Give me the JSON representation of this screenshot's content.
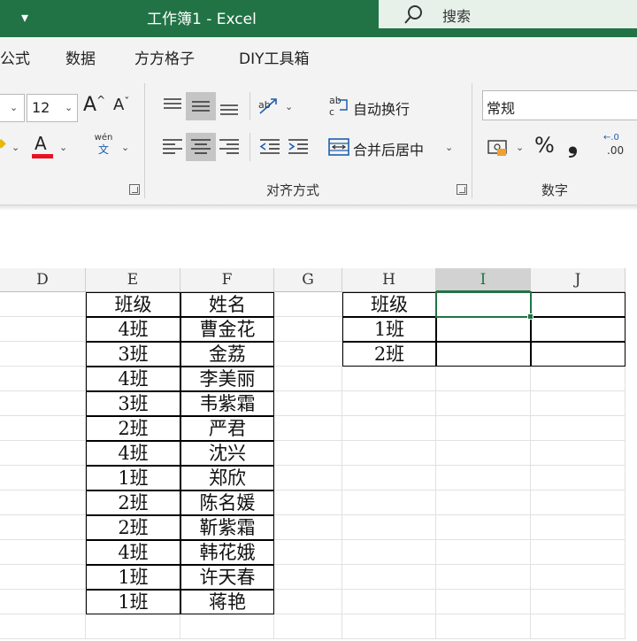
{
  "titlebar": {
    "title": "工作簿1  -  Excel",
    "search_label": "搜索",
    "quick_access_icon": "customize-qat-chevron"
  },
  "tabs": [
    "公式",
    "数据",
    "方方格子",
    "DIY工具箱"
  ],
  "ribbon": {
    "font_size": "12",
    "font_color": "#e81123",
    "wrap_text_label": "自动换行",
    "merge_center_label": "合并后居中",
    "number_format": "常规",
    "alignment_group_label": "对齐方式",
    "number_group_label": "数字",
    "wen_top": "wén",
    "wen_bottom": "文",
    "percent": "%",
    "comma": "❟",
    "dec_right": ".00",
    "dec_left": "←.0"
  },
  "sheet": {
    "columns": [
      "D",
      "E",
      "F",
      "G",
      "H",
      "I",
      "J"
    ],
    "selected_column": "I",
    "table1": {
      "headers": [
        "班级",
        "姓名"
      ],
      "rows": [
        [
          "4班",
          "曹金花"
        ],
        [
          "3班",
          "金荔"
        ],
        [
          "4班",
          "李美丽"
        ],
        [
          "3班",
          "韦紫霜"
        ],
        [
          "2班",
          "严君"
        ],
        [
          "4班",
          "沈兴"
        ],
        [
          "1班",
          "郑欣"
        ],
        [
          "2班",
          "陈名媛"
        ],
        [
          "2班",
          "靳紫霜"
        ],
        [
          "4班",
          "韩花娥"
        ],
        [
          "1班",
          "许天春"
        ],
        [
          "1班",
          "蒋艳"
        ]
      ]
    },
    "table2": {
      "header": "班级",
      "rows": [
        "1班",
        "2班"
      ]
    }
  },
  "colors": {
    "brand": "#217346",
    "search_bg": "#e7f1ea",
    "ribbon_bg": "#f3f3f3"
  }
}
